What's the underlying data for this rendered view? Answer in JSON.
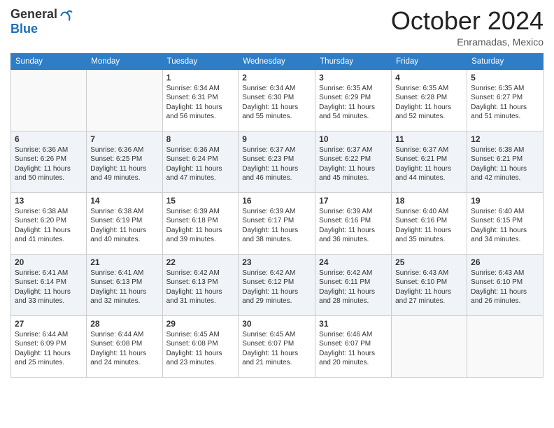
{
  "header": {
    "logo_general": "General",
    "logo_blue": "Blue",
    "month_title": "October 2024",
    "location": "Enramadas, Mexico"
  },
  "weekdays": [
    "Sunday",
    "Monday",
    "Tuesday",
    "Wednesday",
    "Thursday",
    "Friday",
    "Saturday"
  ],
  "weeks": [
    [
      {
        "day": "",
        "info": ""
      },
      {
        "day": "",
        "info": ""
      },
      {
        "day": "1",
        "info": "Sunrise: 6:34 AM\nSunset: 6:31 PM\nDaylight: 11 hours and 56 minutes."
      },
      {
        "day": "2",
        "info": "Sunrise: 6:34 AM\nSunset: 6:30 PM\nDaylight: 11 hours and 55 minutes."
      },
      {
        "day": "3",
        "info": "Sunrise: 6:35 AM\nSunset: 6:29 PM\nDaylight: 11 hours and 54 minutes."
      },
      {
        "day": "4",
        "info": "Sunrise: 6:35 AM\nSunset: 6:28 PM\nDaylight: 11 hours and 52 minutes."
      },
      {
        "day": "5",
        "info": "Sunrise: 6:35 AM\nSunset: 6:27 PM\nDaylight: 11 hours and 51 minutes."
      }
    ],
    [
      {
        "day": "6",
        "info": "Sunrise: 6:36 AM\nSunset: 6:26 PM\nDaylight: 11 hours and 50 minutes."
      },
      {
        "day": "7",
        "info": "Sunrise: 6:36 AM\nSunset: 6:25 PM\nDaylight: 11 hours and 49 minutes."
      },
      {
        "day": "8",
        "info": "Sunrise: 6:36 AM\nSunset: 6:24 PM\nDaylight: 11 hours and 47 minutes."
      },
      {
        "day": "9",
        "info": "Sunrise: 6:37 AM\nSunset: 6:23 PM\nDaylight: 11 hours and 46 minutes."
      },
      {
        "day": "10",
        "info": "Sunrise: 6:37 AM\nSunset: 6:22 PM\nDaylight: 11 hours and 45 minutes."
      },
      {
        "day": "11",
        "info": "Sunrise: 6:37 AM\nSunset: 6:21 PM\nDaylight: 11 hours and 44 minutes."
      },
      {
        "day": "12",
        "info": "Sunrise: 6:38 AM\nSunset: 6:21 PM\nDaylight: 11 hours and 42 minutes."
      }
    ],
    [
      {
        "day": "13",
        "info": "Sunrise: 6:38 AM\nSunset: 6:20 PM\nDaylight: 11 hours and 41 minutes."
      },
      {
        "day": "14",
        "info": "Sunrise: 6:38 AM\nSunset: 6:19 PM\nDaylight: 11 hours and 40 minutes."
      },
      {
        "day": "15",
        "info": "Sunrise: 6:39 AM\nSunset: 6:18 PM\nDaylight: 11 hours and 39 minutes."
      },
      {
        "day": "16",
        "info": "Sunrise: 6:39 AM\nSunset: 6:17 PM\nDaylight: 11 hours and 38 minutes."
      },
      {
        "day": "17",
        "info": "Sunrise: 6:39 AM\nSunset: 6:16 PM\nDaylight: 11 hours and 36 minutes."
      },
      {
        "day": "18",
        "info": "Sunrise: 6:40 AM\nSunset: 6:16 PM\nDaylight: 11 hours and 35 minutes."
      },
      {
        "day": "19",
        "info": "Sunrise: 6:40 AM\nSunset: 6:15 PM\nDaylight: 11 hours and 34 minutes."
      }
    ],
    [
      {
        "day": "20",
        "info": "Sunrise: 6:41 AM\nSunset: 6:14 PM\nDaylight: 11 hours and 33 minutes."
      },
      {
        "day": "21",
        "info": "Sunrise: 6:41 AM\nSunset: 6:13 PM\nDaylight: 11 hours and 32 minutes."
      },
      {
        "day": "22",
        "info": "Sunrise: 6:42 AM\nSunset: 6:13 PM\nDaylight: 11 hours and 31 minutes."
      },
      {
        "day": "23",
        "info": "Sunrise: 6:42 AM\nSunset: 6:12 PM\nDaylight: 11 hours and 29 minutes."
      },
      {
        "day": "24",
        "info": "Sunrise: 6:42 AM\nSunset: 6:11 PM\nDaylight: 11 hours and 28 minutes."
      },
      {
        "day": "25",
        "info": "Sunrise: 6:43 AM\nSunset: 6:10 PM\nDaylight: 11 hours and 27 minutes."
      },
      {
        "day": "26",
        "info": "Sunrise: 6:43 AM\nSunset: 6:10 PM\nDaylight: 11 hours and 26 minutes."
      }
    ],
    [
      {
        "day": "27",
        "info": "Sunrise: 6:44 AM\nSunset: 6:09 PM\nDaylight: 11 hours and 25 minutes."
      },
      {
        "day": "28",
        "info": "Sunrise: 6:44 AM\nSunset: 6:08 PM\nDaylight: 11 hours and 24 minutes."
      },
      {
        "day": "29",
        "info": "Sunrise: 6:45 AM\nSunset: 6:08 PM\nDaylight: 11 hours and 23 minutes."
      },
      {
        "day": "30",
        "info": "Sunrise: 6:45 AM\nSunset: 6:07 PM\nDaylight: 11 hours and 21 minutes."
      },
      {
        "day": "31",
        "info": "Sunrise: 6:46 AM\nSunset: 6:07 PM\nDaylight: 11 hours and 20 minutes."
      },
      {
        "day": "",
        "info": ""
      },
      {
        "day": "",
        "info": ""
      }
    ]
  ]
}
